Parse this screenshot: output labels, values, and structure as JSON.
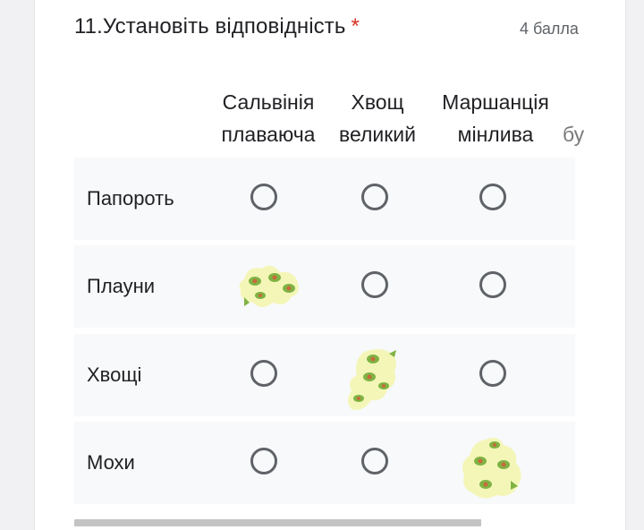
{
  "question": {
    "title": "11.Установіть відповідність",
    "required_mark": "*",
    "points": "4 балла"
  },
  "columns": [
    {
      "label": "Сальвінія\nплаваюча"
    },
    {
      "label": "Хвощ\nвеликий"
    },
    {
      "label": "Маршанція\nмінлива"
    },
    {
      "label": "бу"
    }
  ],
  "rows": [
    {
      "label": "Папороть"
    },
    {
      "label": "Плауни"
    },
    {
      "label": "Хвощі"
    },
    {
      "label": "Мохи"
    }
  ],
  "selections": [
    null,
    0,
    1,
    2
  ],
  "colors": {
    "sticker_base": "#f4f6b8",
    "sticker_green": "#7fb344",
    "sticker_pit": "#c86a3c",
    "radio_border": "#5f6368",
    "required": "#d93025"
  }
}
